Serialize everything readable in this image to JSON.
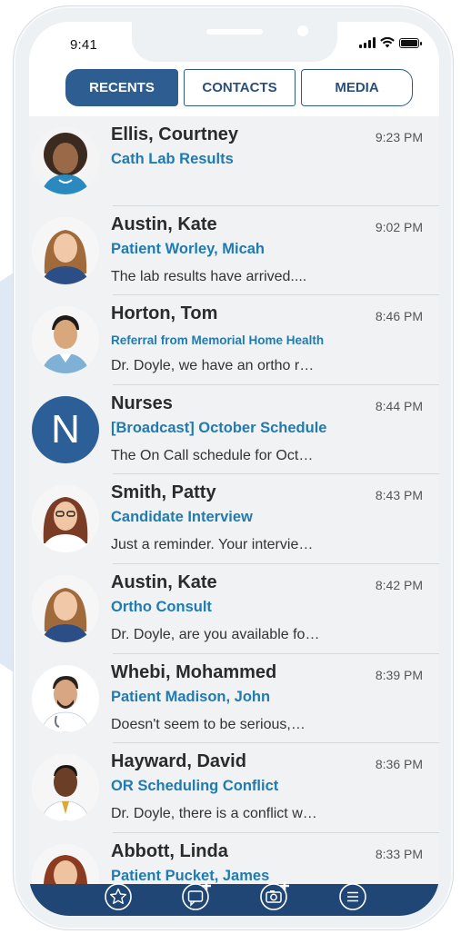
{
  "status_bar": {
    "time": "9:41"
  },
  "tabs": [
    {
      "label": "RECENTS"
    },
    {
      "label": "CONTACTS"
    },
    {
      "label": "MEDIA"
    }
  ],
  "messages": [
    {
      "name": "Ellis, Courtney",
      "time": "9:23 PM",
      "subject": "Cath Lab Results",
      "preview": ""
    },
    {
      "name": "Austin, Kate",
      "time": "9:02 PM",
      "subject": "Patient Worley, Micah",
      "preview": "The lab results have arrived...."
    },
    {
      "name": "Horton, Tom",
      "time": "8:46 PM",
      "subject": "Referral from Memorial Home Health",
      "preview": "Dr. Doyle, we have an ortho r…"
    },
    {
      "name": "Nurses",
      "time": "8:44 PM",
      "subject": "[Broadcast] October Schedule",
      "preview": "The On Call schedule for Oct…",
      "avatar_letter": "N"
    },
    {
      "name": "Smith, Patty",
      "time": "8:43 PM",
      "subject": "Candidate Interview",
      "preview": "Just a reminder. Your intervie…"
    },
    {
      "name": "Austin, Kate",
      "time": "8:42 PM",
      "subject": "Ortho Consult",
      "preview": "Dr. Doyle, are you available fo…"
    },
    {
      "name": "Whebi, Mohammed",
      "time": "8:39 PM",
      "subject": "Patient Madison, John",
      "preview": "Doesn't seem to be serious,…"
    },
    {
      "name": "Hayward, David",
      "time": "8:36 PM",
      "subject": "OR Scheduling Conflict",
      "preview": "Dr. Doyle, there is a conflict w…"
    },
    {
      "name": "Abbott, Linda",
      "time": "8:33 PM",
      "subject": "Patient Pucket, James",
      "preview": ""
    }
  ],
  "bottom_nav": [
    {
      "icon": "star-icon"
    },
    {
      "icon": "new-message-icon"
    },
    {
      "icon": "new-photo-icon"
    },
    {
      "icon": "menu-icon"
    }
  ],
  "colors": {
    "accent": "#2e5d91",
    "subject": "#1f7bb0",
    "nav_bar": "#1f4675"
  }
}
